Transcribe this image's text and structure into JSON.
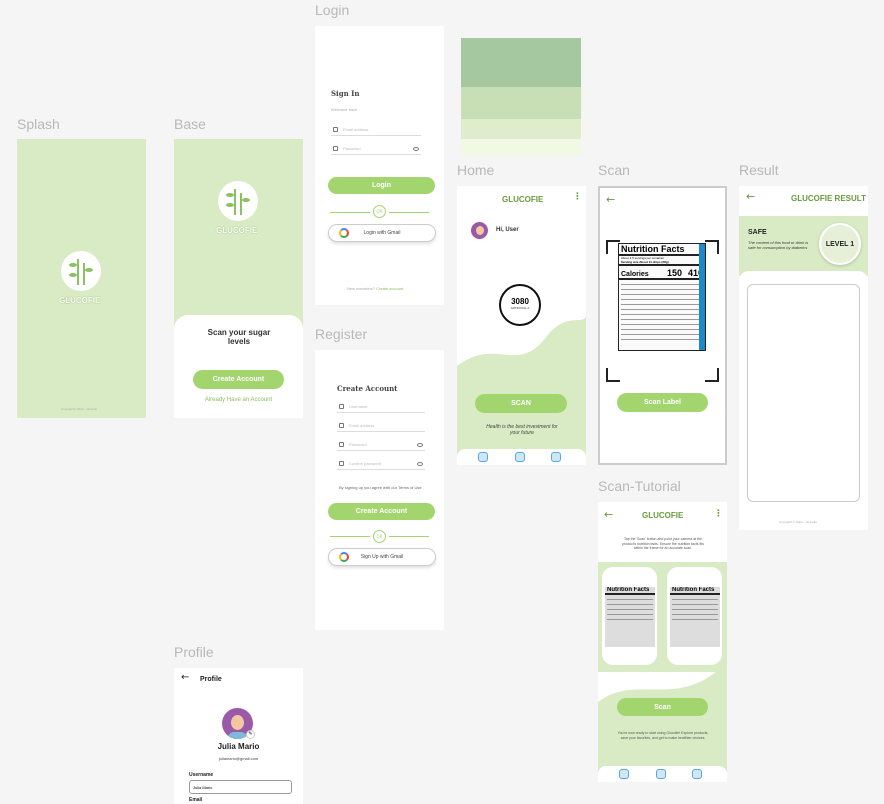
{
  "labels": {
    "splash": "Splash",
    "base": "Base",
    "login": "Login",
    "register": "Register",
    "home": "Home",
    "scan": "Scan",
    "scan_tutorial": "Scan-Tutorial",
    "result": "Result",
    "profile": "Profile"
  },
  "brand": "GLUCOFIE",
  "splash": {
    "copyright": "Copyright© 2024 · Glucofie"
  },
  "base": {
    "title": "Scan your sugar levels",
    "create_button": "Create Account",
    "have_account_link": "Already Have an Account"
  },
  "login": {
    "title": "Sign In",
    "subtitle": "Welcome back",
    "email_placeholder": "Email address",
    "password_placeholder": "Password",
    "login_button": "Login",
    "or": "OR",
    "google_button": "Login with Gmail",
    "footer_prefix": "New members?",
    "footer_link": "Create account"
  },
  "register": {
    "title": "Create Account",
    "username_placeholder": "Username",
    "email_placeholder": "Email address",
    "password_placeholder": "Password",
    "confirm_placeholder": "Confirm password",
    "terms": "By signing up you agree with our Terms of Use",
    "create_button": "Create Account",
    "or": "OR",
    "google_button": "Sign Up with Gmail"
  },
  "home": {
    "header": "GLUCOFIE",
    "greeting": "Hi, User",
    "value": "3080",
    "value_label": "ARTIFICIAL A",
    "scan_button": "SCAN",
    "tagline": "Health is the best investment for your future"
  },
  "scan": {
    "label": "Nutrition Facts",
    "servings": "About 2.5 servings per container",
    "serving_size": "Serving size  About 11 chips (28g)",
    "calories_label": "Calories",
    "cal1": "150",
    "cal2": "410",
    "scan_button": "Scan Label"
  },
  "tutorial": {
    "header": "GLUCOFIE",
    "instruction": "Tap the 'Scan' button and point your camera at the product's nutrition facts. Ensure the nutrition facts fits within the frame for an accurate scan.",
    "scan_button": "Scan",
    "footer": "You're now ready to start using Glucofie! Explore products, save your favorites, and get to make healthier choices.",
    "nf1": "Nutrition Facts",
    "nf2": "Nutrition Facts"
  },
  "result": {
    "header": "GLUCOFIE RESULT",
    "status": "SAFE",
    "description": "The content of this food or drink is safe for consumption by diabetics",
    "level": "LEVEL 1",
    "copyright": "Copyright © Salim · Glucofie"
  },
  "profile": {
    "title": "Profile",
    "name": "Julia Mario",
    "email": "juliamario@gmail.com",
    "username_label": "Username",
    "username_value": "Julia Mario",
    "email_label": "Email"
  },
  "palette": [
    "#a5c8a0",
    "#c8deb4",
    "#e0edcc",
    "#f1f8e4"
  ]
}
